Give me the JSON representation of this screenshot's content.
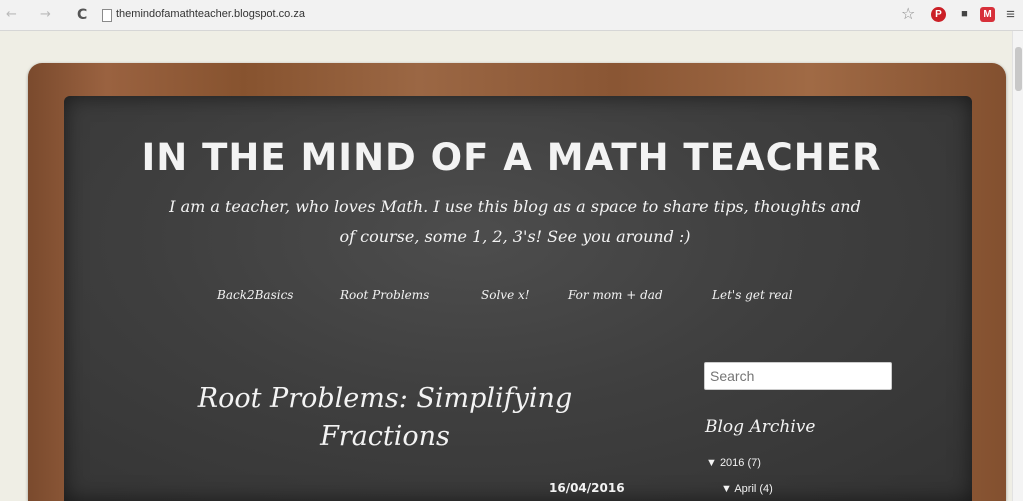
{
  "browser": {
    "url": "themindofamathteacher.blogspot.co.za",
    "back_glyph": "←",
    "forward_glyph": "→",
    "reload_glyph": "C",
    "star_glyph": "☆",
    "pinterest_glyph": "P",
    "ext2_glyph": "■",
    "ext3_glyph": "M",
    "menu_glyph": "≡"
  },
  "blog": {
    "title": "IN THE MIND OF A MATH TEACHER",
    "description": "I am a teacher, who loves Math. I use this blog as a space to share tips, thoughts and of course, some 1, 2, 3's! See you around :)",
    "nav": [
      "Back2Basics",
      "Root Problems",
      "Solve x!",
      "For mom + dad",
      "Let's get real"
    ]
  },
  "post": {
    "title": "Root Problems: Simplifying Fractions",
    "date": "16/04/2016"
  },
  "sidebar": {
    "search_placeholder": "Search",
    "archive_title": "Blog Archive",
    "archive_year": "▼ 2016 (7)",
    "archive_month": "▼ April (4)"
  },
  "colors": {
    "frame_wood": "#8a5634",
    "chalkboard": "#3f3f3f",
    "chalk": "#f3f3f3",
    "page_bg": "#efeee5"
  }
}
